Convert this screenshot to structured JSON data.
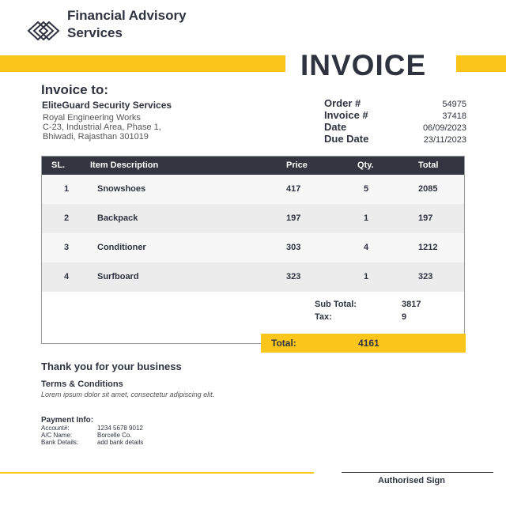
{
  "brand": {
    "name_line1": "Financial Advisory",
    "name_line2": "Services",
    "logo_icon": "interlocking-diamonds-icon",
    "accent_color": "#fbc519",
    "dark_color": "#333641"
  },
  "document_title": "INVOICE",
  "bill_to": {
    "heading": "Invoice to:",
    "company": "EliteGuard Security Services",
    "address_lines": [
      "Royal Engineering Works",
      "C-23, Industrial Area, Phase 1,",
      "Bhiwadi, Rajasthan 301019"
    ]
  },
  "meta": [
    {
      "label": "Order #",
      "value": "54975"
    },
    {
      "label": "Invoice #",
      "value": "37418"
    },
    {
      "label": "Date",
      "value": "06/09/2023"
    },
    {
      "label": "Due Date",
      "value": "23/11/2023"
    }
  ],
  "table": {
    "headers": {
      "sl": "SL.",
      "desc": "Item Description",
      "price": "Price",
      "qty": "Qty.",
      "total": "Total"
    },
    "rows": [
      {
        "sl": "1",
        "desc": "Snowshoes",
        "price": "417",
        "qty": "5",
        "total": "2085"
      },
      {
        "sl": "2",
        "desc": "Backpack",
        "price": "197",
        "qty": "1",
        "total": "197"
      },
      {
        "sl": "3",
        "desc": "Conditioner",
        "price": "303",
        "qty": "4",
        "total": "1212"
      },
      {
        "sl": "4",
        "desc": "Surfboard",
        "price": "323",
        "qty": "1",
        "total": "323"
      }
    ]
  },
  "summary": {
    "subtotal_label": "Sub Total:",
    "subtotal_value": "3817",
    "tax_label": "Tax:",
    "tax_value": "9",
    "total_label": "Total:",
    "total_value": "4161"
  },
  "footer": {
    "thanks": "Thank you for your business",
    "terms_heading": "Terms & Conditions",
    "terms_text": "Lorem ipsum dolor sit amet, consectetur adipiscing elit.",
    "payment_heading": "Payment Info:",
    "payment": [
      {
        "label": "Account#:",
        "value": "1234 5678 9012"
      },
      {
        "label": "A/C Name:",
        "value": "Borcelle Co."
      },
      {
        "label": "Bank Details:",
        "value": "add bank details"
      }
    ],
    "signature": "Authorised Sign"
  }
}
